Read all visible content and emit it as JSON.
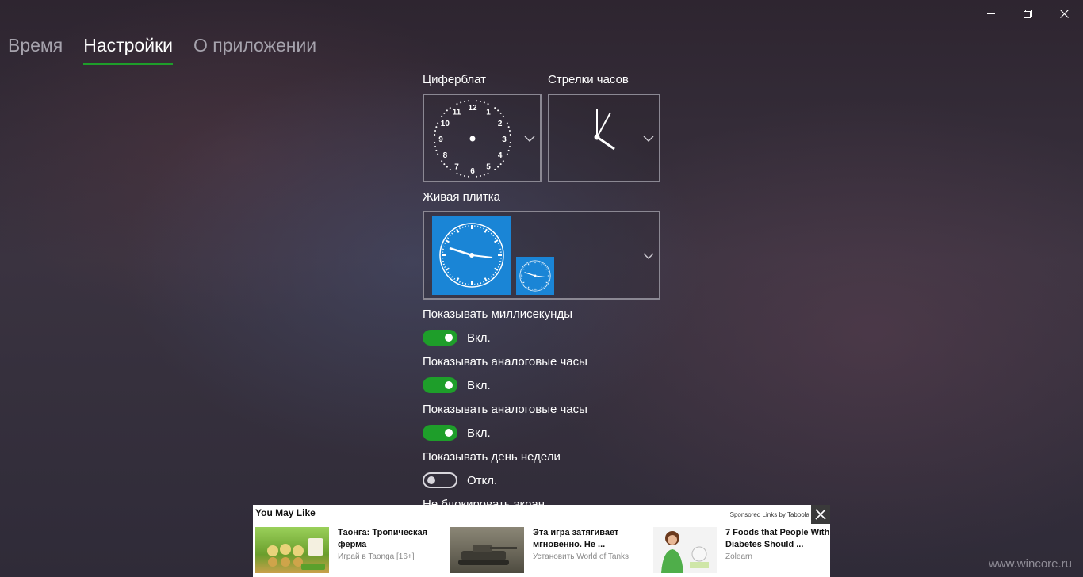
{
  "window": {
    "minimize_icon": "minimize-icon",
    "restore_icon": "restore-icon",
    "close_icon": "close-icon"
  },
  "nav": {
    "tabs": [
      {
        "label": "Время"
      },
      {
        "label": "Настройки",
        "active": true
      },
      {
        "label": "О приложении"
      }
    ]
  },
  "settings": {
    "dial_label": "Циферблат",
    "hands_label": "Стрелки часов",
    "dial_numbers": [
      "12",
      "1",
      "2",
      "3",
      "4",
      "5",
      "6",
      "7",
      "8",
      "9",
      "10",
      "11"
    ],
    "live_tile_label": "Живая плитка",
    "accent_color": "#1e9e2a",
    "tile_color": "#1a85d6",
    "toggles": [
      {
        "label": "Показывать миллисекунды",
        "state_text": "Вкл.",
        "on": true
      },
      {
        "label": "Показывать аналоговые часы",
        "state_text": "Вкл.",
        "on": true
      },
      {
        "label": "Показывать аналоговые часы",
        "state_text": "Вкл.",
        "on": true
      },
      {
        "label": "Показывать день недели",
        "state_text": "Откл.",
        "on": false
      }
    ],
    "partial_label": "Не блокировать экран"
  },
  "ad": {
    "title": "You May Like",
    "sponsored": "Sponsored Links by Taboola",
    "items": [
      {
        "headline": "Таонга: Тропическая ферма",
        "source": "Играй в Taonga [16+]"
      },
      {
        "headline": "Эта игра затягивает мгновенно. Не ...",
        "source": "Установить World of Tanks"
      },
      {
        "headline": "7 Foods that People With Diabetes Should ...",
        "source": "Zolearn"
      }
    ]
  },
  "watermark": "www.wincore.ru"
}
